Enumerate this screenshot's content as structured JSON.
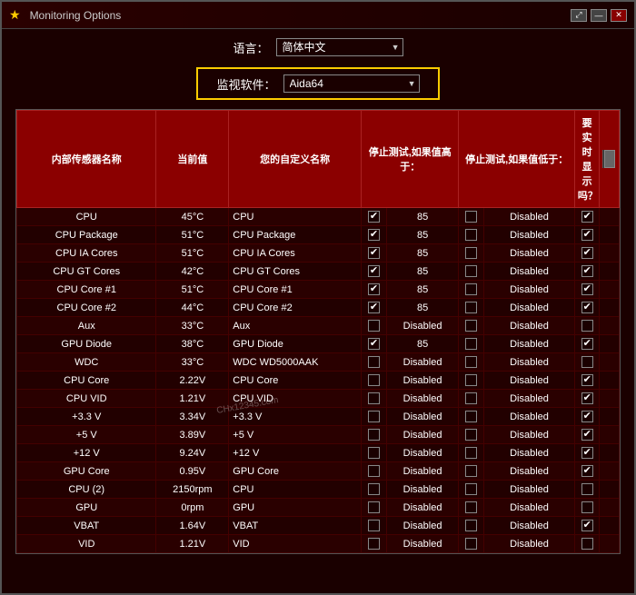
{
  "window": {
    "title": "Monitoring Options",
    "star": "★"
  },
  "titlebar_controls": {
    "expand": "⤢",
    "minimize": "—",
    "close": "✕"
  },
  "lang_section": {
    "label": "语言：",
    "options": [
      "简体中文"
    ],
    "selected": "简体中文"
  },
  "monitor_section": {
    "label": "监视软件：",
    "options": [
      "Aida64"
    ],
    "selected": "Aida64"
  },
  "table": {
    "headers": {
      "sensor_name": "内部传感器名称",
      "current_val": "当前值",
      "custom_name": "您的自定义名称",
      "stop_high_cb": "",
      "stop_high": "停止测试,如果值高于：",
      "stop_low_cb": "",
      "stop_low": "停止测试,如果值低于：",
      "realtime": "要实时显示吗？"
    },
    "rows": [
      {
        "name": "CPU",
        "val": "45°C",
        "custom": "CPU",
        "cbhi": true,
        "hi": "85",
        "cblo": false,
        "lo": "Disabled",
        "cbrt": true
      },
      {
        "name": "CPU Package",
        "val": "51°C",
        "custom": "CPU Package",
        "cbhi": true,
        "hi": "85",
        "cblo": false,
        "lo": "Disabled",
        "cbrt": true
      },
      {
        "name": "CPU IA Cores",
        "val": "51°C",
        "custom": "CPU IA Cores",
        "cbhi": true,
        "hi": "85",
        "cblo": false,
        "lo": "Disabled",
        "cbrt": true
      },
      {
        "name": "CPU GT Cores",
        "val": "42°C",
        "custom": "CPU GT Cores",
        "cbhi": true,
        "hi": "85",
        "cblo": false,
        "lo": "Disabled",
        "cbrt": true
      },
      {
        "name": "CPU Core #1",
        "val": "51°C",
        "custom": "CPU Core #1",
        "cbhi": true,
        "hi": "85",
        "cblo": false,
        "lo": "Disabled",
        "cbrt": true
      },
      {
        "name": "CPU Core #2",
        "val": "44°C",
        "custom": "CPU Core #2",
        "cbhi": true,
        "hi": "85",
        "cblo": false,
        "lo": "Disabled",
        "cbrt": true
      },
      {
        "name": "Aux",
        "val": "33°C",
        "custom": "Aux",
        "cbhi": false,
        "hi": "Disabled",
        "cblo": false,
        "lo": "Disabled",
        "cbrt": false
      },
      {
        "name": "GPU Diode",
        "val": "38°C",
        "custom": "GPU Diode",
        "cbhi": true,
        "hi": "85",
        "cblo": false,
        "lo": "Disabled",
        "cbrt": true
      },
      {
        "name": "WDC",
        "val": "33°C",
        "custom": "WDC WD5000AAK",
        "cbhi": false,
        "hi": "Disabled",
        "cblo": false,
        "lo": "Disabled",
        "cbrt": false
      },
      {
        "name": "CPU Core",
        "val": "2.22V",
        "custom": "CPU Core",
        "cbhi": false,
        "hi": "Disabled",
        "cblo": false,
        "lo": "Disabled",
        "cbrt": true
      },
      {
        "name": "CPU VID",
        "val": "1.21V",
        "custom": "CPU VID",
        "cbhi": false,
        "hi": "Disabled",
        "cblo": false,
        "lo": "Disabled",
        "cbrt": true
      },
      {
        "name": "+3.3 V",
        "val": "3.34V",
        "custom": "+3.3 V",
        "cbhi": false,
        "hi": "Disabled",
        "cblo": false,
        "lo": "Disabled",
        "cbrt": true
      },
      {
        "name": "+5 V",
        "val": "3.89V",
        "custom": "+5 V",
        "cbhi": false,
        "hi": "Disabled",
        "cblo": false,
        "lo": "Disabled",
        "cbrt": true
      },
      {
        "name": "+12 V",
        "val": "9.24V",
        "custom": "+12 V",
        "cbhi": false,
        "hi": "Disabled",
        "cblo": false,
        "lo": "Disabled",
        "cbrt": true
      },
      {
        "name": "GPU Core",
        "val": "0.95V",
        "custom": "GPU Core",
        "cbhi": false,
        "hi": "Disabled",
        "cblo": false,
        "lo": "Disabled",
        "cbrt": true
      },
      {
        "name": "CPU (2)",
        "val": "2150rpm",
        "custom": "CPU",
        "cbhi": false,
        "hi": "Disabled",
        "cblo": false,
        "lo": "Disabled",
        "cbrt": false
      },
      {
        "name": "GPU",
        "val": "0rpm",
        "custom": "GPU",
        "cbhi": false,
        "hi": "Disabled",
        "cblo": false,
        "lo": "Disabled",
        "cbrt": false
      },
      {
        "name": "VBAT",
        "val": "1.64V",
        "custom": "VBAT",
        "cbhi": false,
        "hi": "Disabled",
        "cblo": false,
        "lo": "Disabled",
        "cbrt": true
      },
      {
        "name": "VID",
        "val": "1.21V",
        "custom": "VID",
        "cbhi": false,
        "hi": "Disabled",
        "cblo": false,
        "lo": "Disabled",
        "cbrt": false
      }
    ]
  },
  "watermark": "CHx12345.com"
}
